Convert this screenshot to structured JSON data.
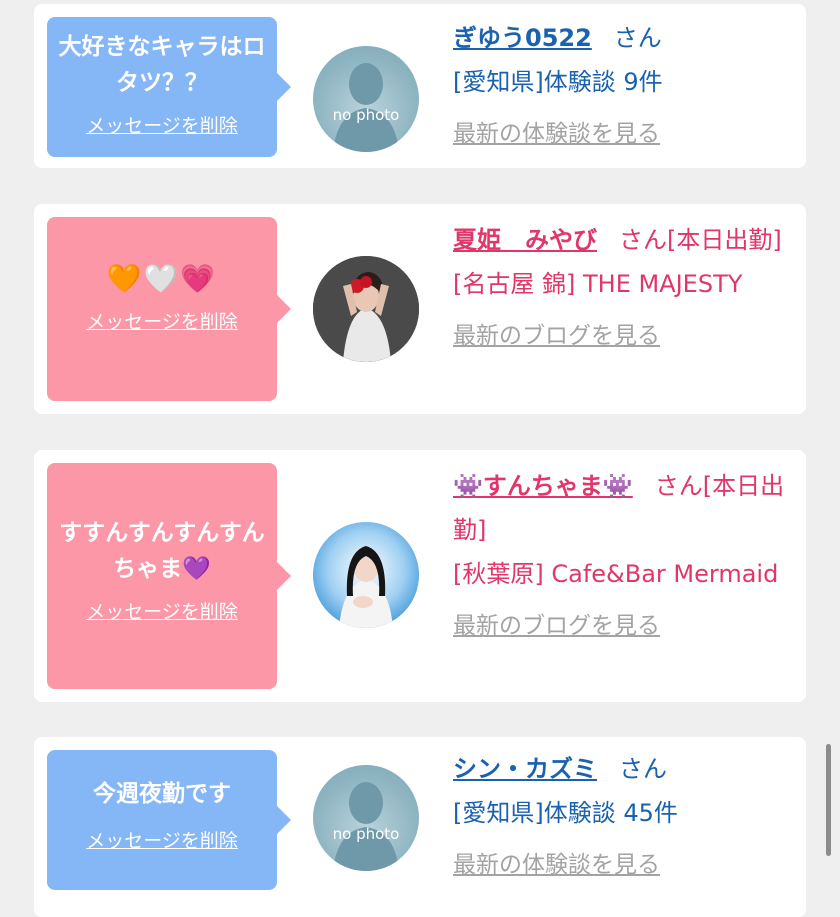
{
  "cards": [
    {
      "message": "大好きなキャラはロタツ？？",
      "delete_label": "メッセージを削除",
      "avatar_text": "no photo",
      "name": "ぎゆう0522",
      "suffix": "さん",
      "detail": "[愛知県]体験談 9件",
      "link": "最新の体験談を見る"
    },
    {
      "message": "🧡🤍💗",
      "delete_label": "メッセージを削除",
      "name": "夏姫　みやび",
      "suffix": "さん[本日出勤]",
      "detail": "[名古屋 錦] THE MAJESTY",
      "link": "最新のブログを見る"
    },
    {
      "message": "すすんすんすんすんちゃま💜",
      "delete_label": "メッセージを削除",
      "name": "👾すんちゃま👾",
      "suffix": "さん[本日出勤]",
      "detail": "[秋葉原] Cafe&Bar Mermaid",
      "link": "最新のブログを見る"
    },
    {
      "message": "今週夜勤です",
      "delete_label": "メッセージを削除",
      "avatar_text": "no photo",
      "name": "シン・カズミ",
      "suffix": "さん",
      "detail": "[愛知県]体験談 45件",
      "link": "最新の体験談を見る"
    }
  ],
  "colors": {
    "member_bubble": "#85b6f5",
    "cast_bubble": "#fb97a7",
    "member_text": "#1a62b0",
    "cast_text": "#e0366a",
    "link_gray": "#a3a3a3"
  }
}
